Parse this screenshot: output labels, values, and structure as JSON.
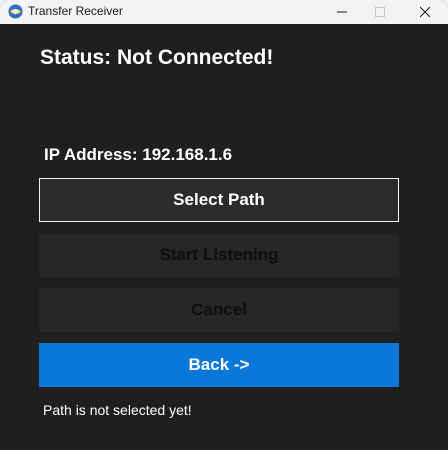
{
  "window": {
    "title": "Transfer Receiver",
    "icon": "transfer-app-icon",
    "controls": [
      "minimize-icon",
      "maximize-icon",
      "close-icon"
    ]
  },
  "main": {
    "status_text": "Status: Not Connected!",
    "ip_text": "IP Address: 192.168.1.6",
    "buttons": {
      "select_path": "Select Path",
      "start_listening": "Start Listening",
      "cancel": "Cancel",
      "back": "Back ->"
    },
    "path_message": "Path is not selected yet!"
  },
  "colors": {
    "background": "#1f1f1f",
    "accent": "#0a78d8",
    "disabled_button": "#262626"
  }
}
